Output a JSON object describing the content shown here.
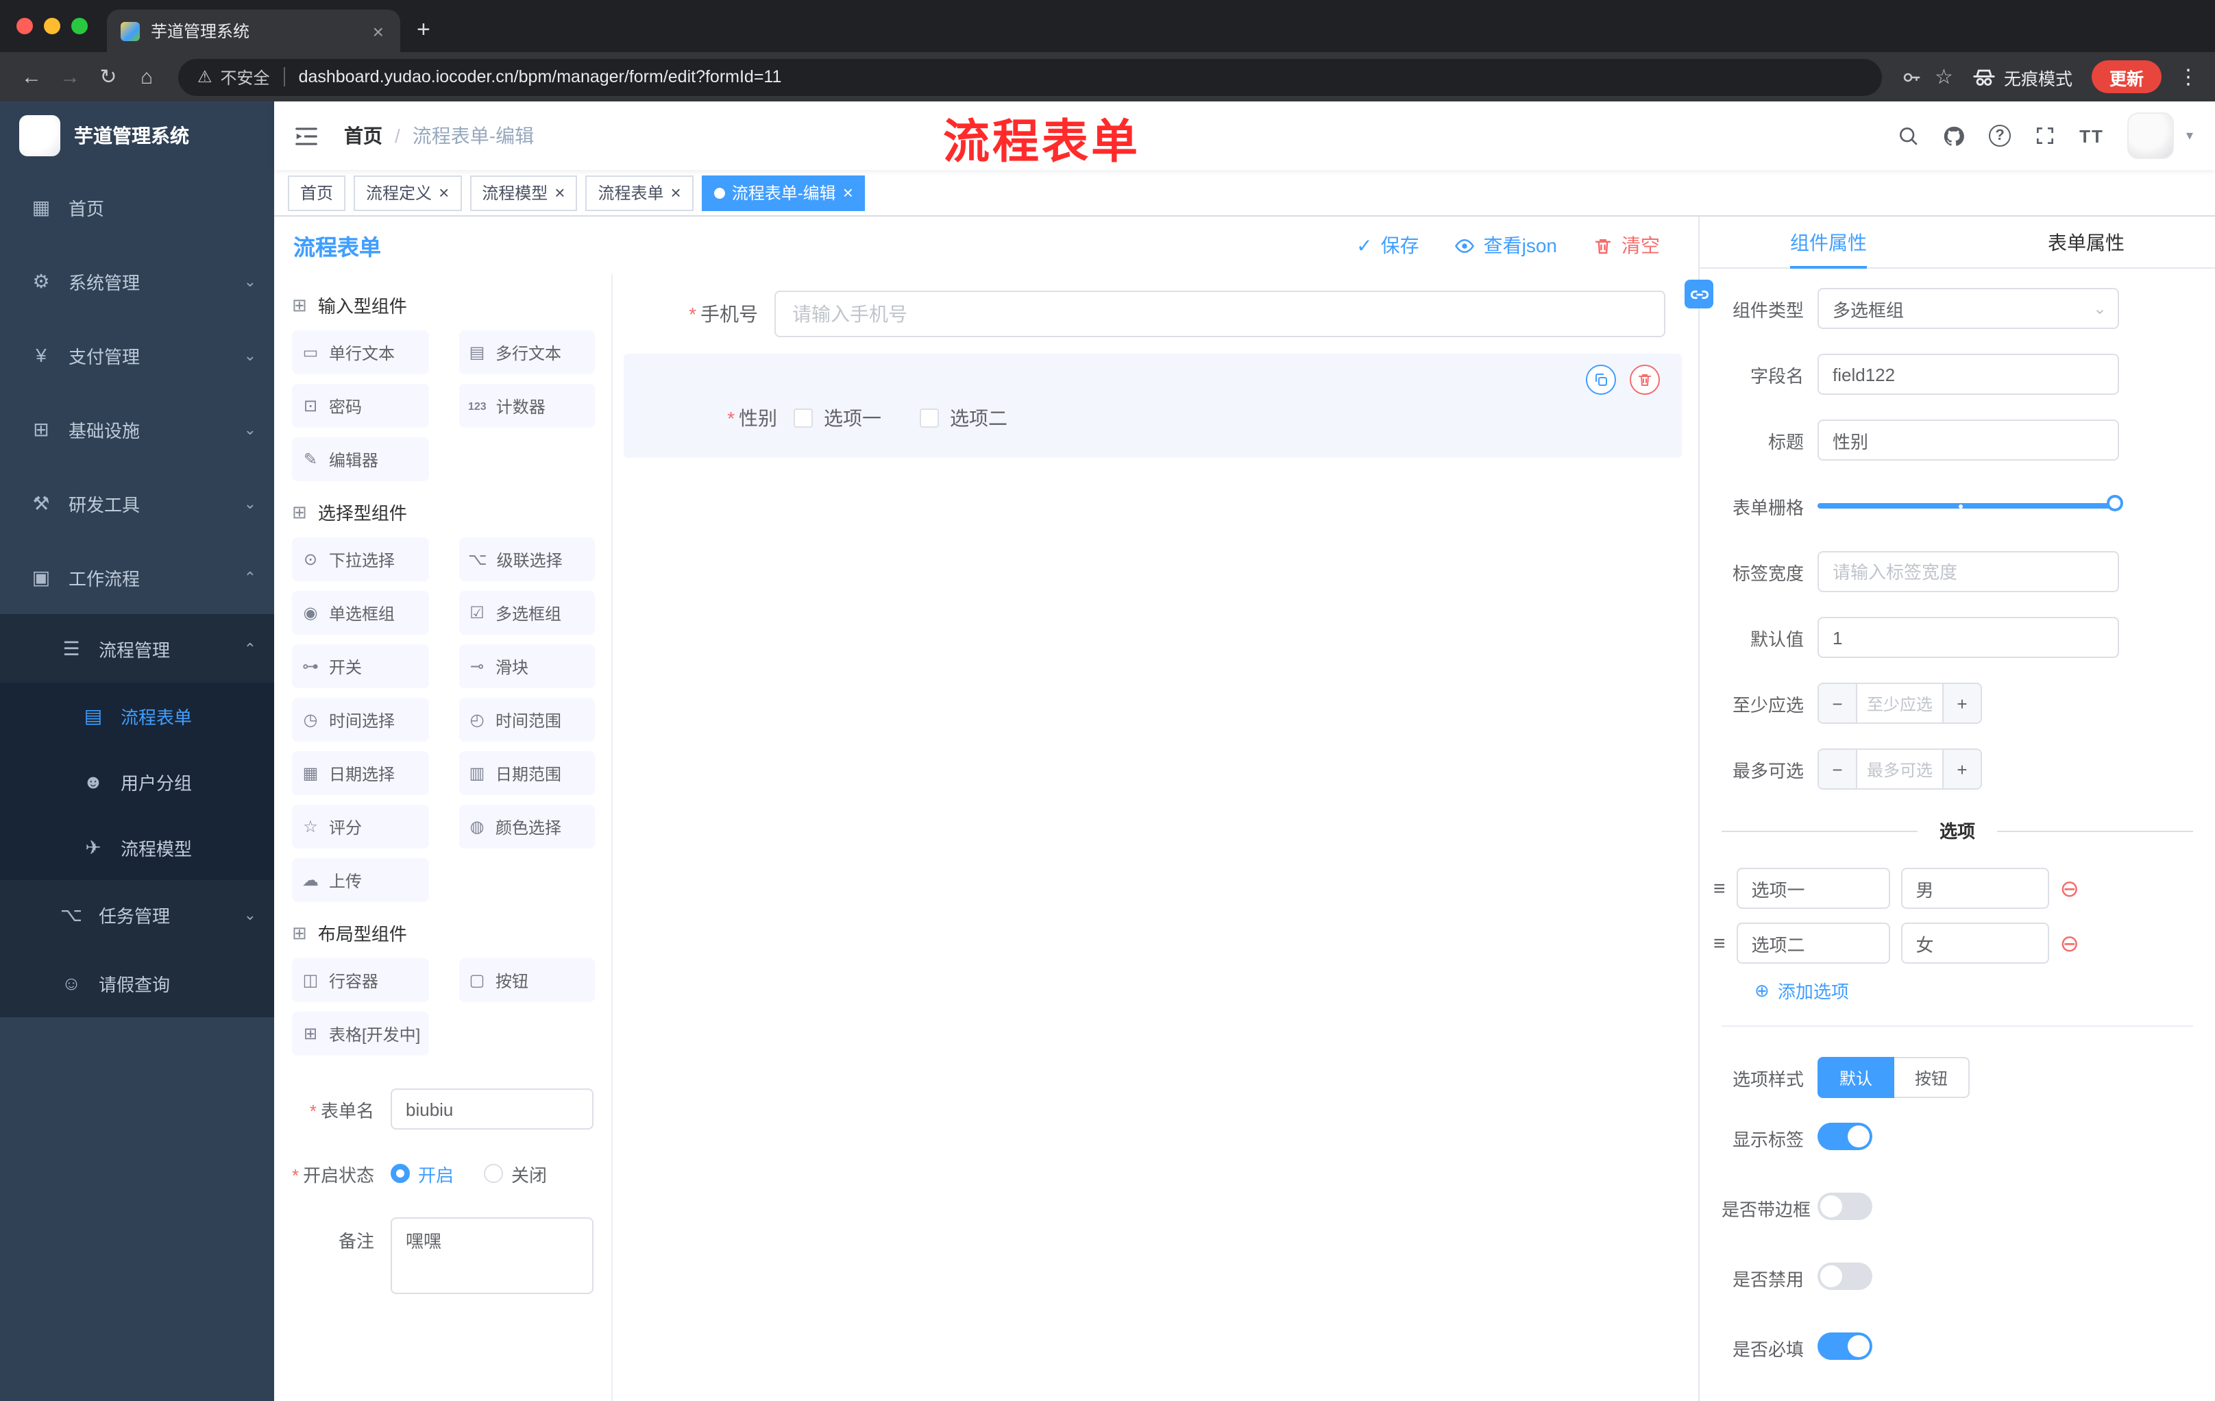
{
  "browser": {
    "tab_title": "芋道管理系统",
    "security_label": "不安全",
    "url": "dashboard.yudao.iocoder.cn/bpm/manager/form/edit?formId=11",
    "incognito_label": "无痕模式",
    "update_label": "更新"
  },
  "annotation": "流程表单",
  "sidebar": {
    "logo_title": "芋道管理系统",
    "items": {
      "home": "首页",
      "system": "系统管理",
      "payment": "支付管理",
      "infra": "基础设施",
      "rdtools": "研发工具",
      "workflow": "工作流程",
      "process_mgmt": "流程管理",
      "process_form": "流程表单",
      "user_group": "用户分组",
      "process_model": "流程模型",
      "task_mgmt": "任务管理",
      "leave_query": "请假查询"
    }
  },
  "navbar": {
    "breadcrumb_home": "首页",
    "breadcrumb_current": "流程表单-编辑"
  },
  "tags": [
    {
      "label": "首页"
    },
    {
      "label": "流程定义"
    },
    {
      "label": "流程模型"
    },
    {
      "label": "流程表单"
    },
    {
      "label": "流程表单-编辑"
    }
  ],
  "editor": {
    "title": "流程表单",
    "save": "保存",
    "view_json": "查看json",
    "clear": "清空",
    "groups": {
      "input_title": "输入型组件",
      "select_title": "选择型组件",
      "layout_title": "布局型组件"
    },
    "components": {
      "single_text": "单行文本",
      "multi_text": "多行文本",
      "password": "密码",
      "counter": "计数器",
      "editor": "编辑器",
      "select": "下拉选择",
      "cascade": "级联选择",
      "radio_group": "单选框组",
      "checkbox_group": "多选框组",
      "switch": "开关",
      "slider": "滑块",
      "time": "时间选择",
      "time_range": "时间范围",
      "date": "日期选择",
      "date_range": "日期范围",
      "rate": "评分",
      "color": "颜色选择",
      "upload": "上传",
      "row": "行容器",
      "button": "按钮",
      "table": "表格[开发中]"
    },
    "meta": {
      "form_name_label": "表单名",
      "form_name_value": "biubiu",
      "status_label": "开启状态",
      "status_on": "开启",
      "status_off": "关闭",
      "remark_label": "备注",
      "remark_value": "嘿嘿"
    },
    "canvas": {
      "phone_label": "手机号",
      "phone_placeholder": "请输入手机号",
      "gender_label": "性别",
      "gender_option1": "选项一",
      "gender_option2": "选项二"
    }
  },
  "properties": {
    "tab_component": "组件属性",
    "tab_form": "表单属性",
    "component_type_label": "组件类型",
    "component_type_value": "多选框组",
    "field_name_label": "字段名",
    "field_name_value": "field122",
    "title_label": "标题",
    "title_value": "性别",
    "grid_label": "表单栅格",
    "label_width_label": "标签宽度",
    "label_width_placeholder": "请输入标签宽度",
    "default_label": "默认值",
    "default_value": "1",
    "min_label": "至少应选",
    "min_placeholder": "至少应选",
    "max_label": "最多可选",
    "max_placeholder": "最多可选",
    "options_title": "选项",
    "options": [
      {
        "label": "选项一",
        "value": "男"
      },
      {
        "label": "选项二",
        "value": "女"
      }
    ],
    "add_option": "添加选项",
    "style_label": "选项样式",
    "style_default": "默认",
    "style_button": "按钮",
    "show_label": "显示标签",
    "with_border": "是否带边框",
    "disabled": "是否禁用",
    "required": "是否必填"
  },
  "colors": {
    "accent": "#409EFF",
    "danger": "#F56C6C",
    "sidebar_bg": "#304156",
    "sidebar_sub_bg": "#1F2D3D",
    "selected_field_bg": "#F4F6FE",
    "update_button": "#E8453C",
    "annotation": "#FF2B2B",
    "traffic_red": "#FF5F57",
    "traffic_yellow": "#FEBC2E",
    "traffic_green": "#28C840"
  },
  "icons": {
    "back": "←",
    "forward": "→",
    "reload": "↻",
    "home": "⌂",
    "warning": "⚠",
    "star": "☆",
    "kebab": "⋮",
    "new_tab": "+",
    "close": "×",
    "chevron_down": "⌄",
    "chevron_up": "⌃",
    "caret_down": "▾",
    "slash": "/",
    "question": "?",
    "font_size": "TT",
    "menu_home": "▦",
    "menu_system": "⚙",
    "menu_payment": "¥",
    "menu_infra": "⊞",
    "menu_rdtools": "⚒",
    "menu_workflow": "▣",
    "menu_process_mgmt": "☰",
    "menu_process_form": "▤",
    "menu_user_group": "☻",
    "menu_process_model": "✈",
    "menu_task": "⌥",
    "menu_leave": "☺",
    "group_box": "⊞",
    "c_single": "▭",
    "c_multi": "▤",
    "c_pass": "⊡",
    "c_counter": "123",
    "c_editor": "✎",
    "c_select": "⊙",
    "c_cascade": "⌥",
    "c_radio": "◉",
    "c_check": "☑",
    "c_switch": "⊶",
    "c_slider": "⊸",
    "c_time": "◷",
    "c_timerange": "◴",
    "c_date": "▦",
    "c_daterange": "▥",
    "c_rate": "☆",
    "c_color": "◍",
    "c_upload": "☁",
    "c_row": "◫",
    "c_button": "▢",
    "c_table": "⊞",
    "check": "✓",
    "opt_drag": "≡",
    "remove": "⊖",
    "add": "⊕",
    "minus": "−",
    "plus": "+"
  }
}
